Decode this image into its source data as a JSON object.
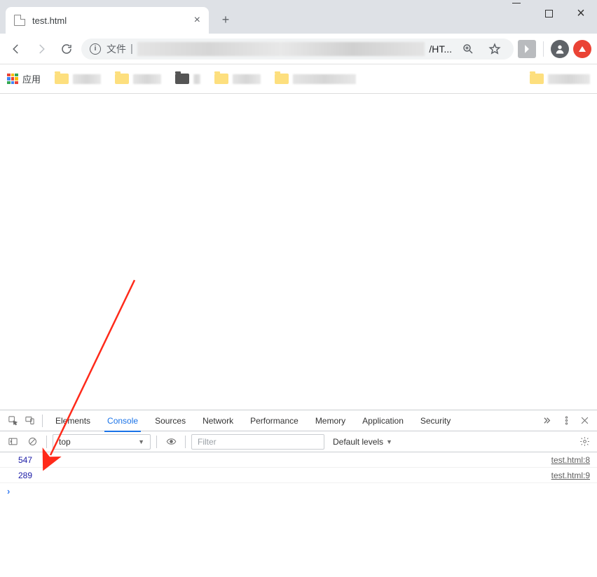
{
  "tab": {
    "title": "test.html"
  },
  "omnibox": {
    "prefix": "文件",
    "suffix": "/HT..."
  },
  "bookmarks": {
    "apps_label": "应用"
  },
  "devtools": {
    "tabs": {
      "elements": "Elements",
      "console": "Console",
      "sources": "Sources",
      "network": "Network",
      "performance": "Performance",
      "memory": "Memory",
      "application": "Application",
      "security": "Security"
    },
    "context": "top",
    "filter_placeholder": "Filter",
    "levels": "Default levels",
    "logs": [
      {
        "value": "547",
        "source": "test.html:8"
      },
      {
        "value": "289",
        "source": "test.html:9"
      }
    ]
  }
}
